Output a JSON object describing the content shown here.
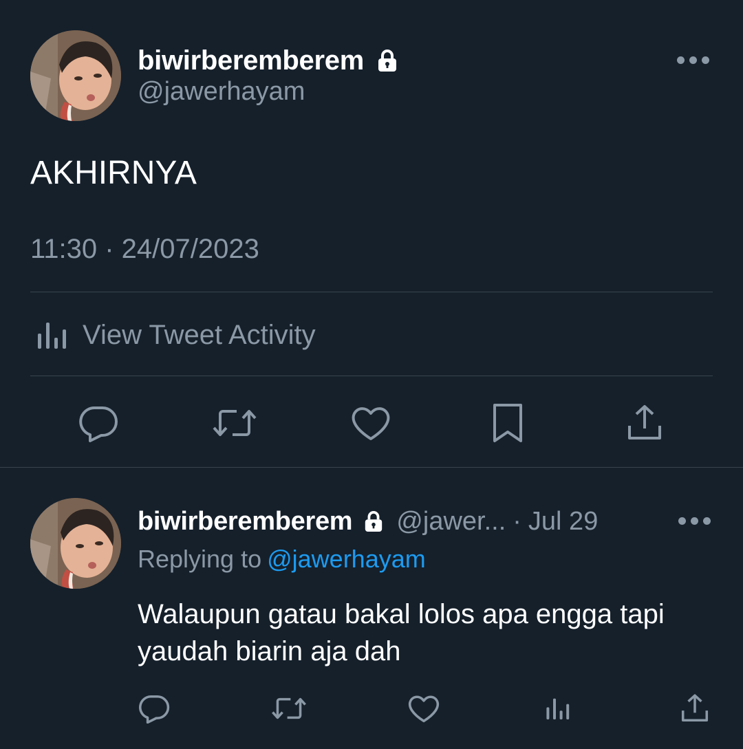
{
  "main_tweet": {
    "display_name": "biwirberemberem",
    "handle": "@jawerhayam",
    "text": "AKHIRNYA",
    "timestamp": "11:30 · 24/07/2023",
    "activity_label": "View Tweet Activity",
    "icons": {
      "lock": "lock-icon",
      "more": "more-horizontal-icon",
      "activity": "bar-chart-icon"
    },
    "actions": [
      {
        "name": "reply",
        "icon": "reply-icon"
      },
      {
        "name": "retweet",
        "icon": "retweet-icon"
      },
      {
        "name": "like",
        "icon": "heart-icon"
      },
      {
        "name": "bookmark",
        "icon": "bookmark-icon"
      },
      {
        "name": "share",
        "icon": "share-icon"
      }
    ]
  },
  "reply_tweet": {
    "display_name": "biwirberemberem",
    "handle": "@jawer...",
    "separator": "·",
    "date": "Jul 29",
    "replying_prefix": "Replying to",
    "replying_to": "@jawerhayam",
    "text": "Walaupun gatau bakal lolos apa engga tapi yaudah biarin aja dah",
    "actions": [
      {
        "name": "reply",
        "icon": "reply-icon"
      },
      {
        "name": "retweet",
        "icon": "retweet-icon"
      },
      {
        "name": "like",
        "icon": "heart-icon"
      },
      {
        "name": "views",
        "icon": "bar-chart-icon"
      },
      {
        "name": "share",
        "icon": "share-icon"
      }
    ]
  },
  "colors": {
    "background": "#15202b",
    "primary_text": "#ffffff",
    "secondary_text": "#8b98a5",
    "divider": "#38444d",
    "link": "#1d9bf0"
  }
}
